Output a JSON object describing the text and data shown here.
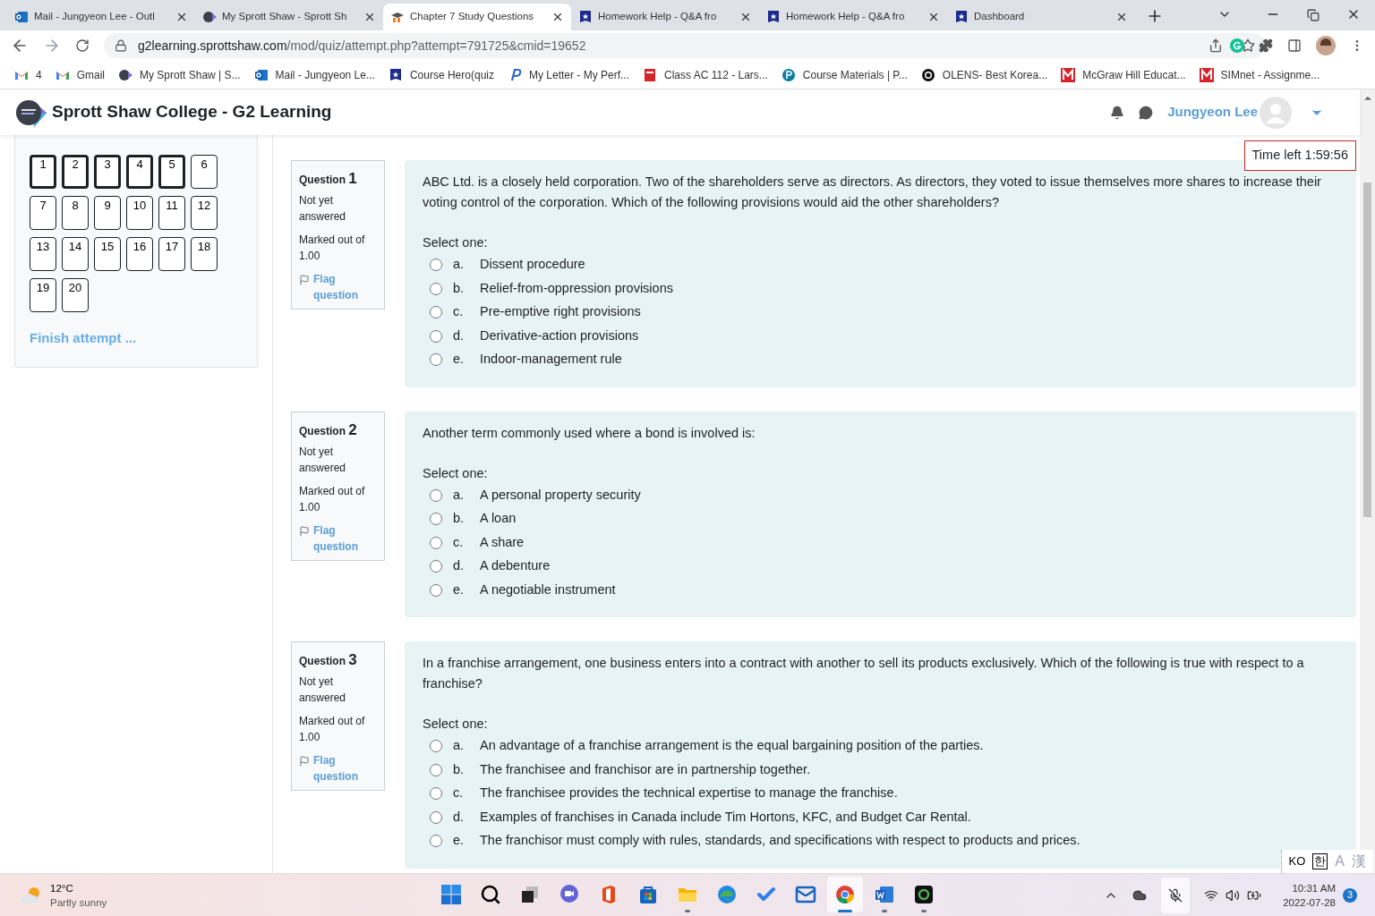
{
  "browser": {
    "tabs": [
      {
        "title": "Mail - Jungyeon Lee - Outl",
        "kind": "outlook",
        "selected": false
      },
      {
        "title": "My Sprott Shaw - Sprott Sh",
        "kind": "sprott",
        "selected": false
      },
      {
        "title": "Chapter 7 Study Questions",
        "kind": "moodle",
        "selected": true
      },
      {
        "title": "Homework Help - Q&A fro",
        "kind": "coursehero",
        "selected": false
      },
      {
        "title": "Homework Help - Q&A fro",
        "kind": "coursehero",
        "selected": false
      },
      {
        "title": "Dashboard",
        "kind": "coursehero",
        "selected": false
      }
    ],
    "url_host": "g2learning.sprottshaw.com",
    "url_path": "/mod/quiz/attempt.php?attempt=791725&cmid=19652",
    "bookmarks": [
      {
        "label": "4",
        "kind": "gmail"
      },
      {
        "label": "Gmail",
        "kind": "gmail"
      },
      {
        "label": "My Sprott Shaw | S...",
        "kind": "sprott"
      },
      {
        "label": "Mail - Jungyeon Le...",
        "kind": "outlook"
      },
      {
        "label": "Course Hero(quiz",
        "kind": "coursehero"
      },
      {
        "label": "My Letter - My Perf...",
        "kind": "pletter"
      },
      {
        "label": "Class AC 112 - Lars...",
        "kind": "mcgraw_small"
      },
      {
        "label": "Course Materials | P...",
        "kind": "pearson"
      },
      {
        "label": "OLENS- Best Korea...",
        "kind": "olens"
      },
      {
        "label": "McGraw Hill Educat...",
        "kind": "mcgraw"
      },
      {
        "label": "SIMnet - Assignme...",
        "kind": "mcgraw"
      }
    ]
  },
  "site": {
    "title": "Sprott Shaw College - G2 Learning",
    "user_name": "Jungyeon Lee"
  },
  "timer": "Time left 1:59:56",
  "quiz_nav": {
    "buttons": [
      {
        "label": "1",
        "on_page": true
      },
      {
        "label": "2",
        "on_page": true
      },
      {
        "label": "3",
        "on_page": true
      },
      {
        "label": "4",
        "on_page": true
      },
      {
        "label": "5",
        "on_page": true
      },
      {
        "label": "6",
        "on_page": false
      },
      {
        "label": "7",
        "on_page": false
      },
      {
        "label": "8",
        "on_page": false
      },
      {
        "label": "9",
        "on_page": false
      },
      {
        "label": "10",
        "on_page": false
      },
      {
        "label": "11",
        "on_page": false
      },
      {
        "label": "12",
        "on_page": false
      },
      {
        "label": "13",
        "on_page": false
      },
      {
        "label": "14",
        "on_page": false
      },
      {
        "label": "15",
        "on_page": false
      },
      {
        "label": "16",
        "on_page": false
      },
      {
        "label": "17",
        "on_page": false
      },
      {
        "label": "18",
        "on_page": false
      },
      {
        "label": "19",
        "on_page": false
      },
      {
        "label": "20",
        "on_page": false
      }
    ],
    "finish_link": "Finish attempt ..."
  },
  "questions": [
    {
      "label": "Question",
      "number": "1",
      "status": "Not yet answered",
      "marked": "Marked out of 1.00",
      "flag": "Flag question",
      "text": "ABC Ltd. is a closely held corporation. Two of the shareholders serve as directors. As directors, they voted to issue themselves more shares to increase their voting control of the corporation. Which of the following provisions would aid the other shareholders?",
      "prompt": "Select one:",
      "options": [
        {
          "letter": "a.",
          "text": "Dissent procedure",
          "selected": false
        },
        {
          "letter": "b.",
          "text": "Relief-from-oppression provisions",
          "selected": false
        },
        {
          "letter": "c.",
          "text": "Pre-emptive right provisions",
          "selected": false
        },
        {
          "letter": "d.",
          "text": "Derivative-action provisions",
          "selected": false
        },
        {
          "letter": "e.",
          "text": "Indoor-management rule",
          "selected": false
        }
      ]
    },
    {
      "label": "Question",
      "number": "2",
      "status": "Not yet answered",
      "marked": "Marked out of 1.00",
      "flag": "Flag question",
      "text": "Another term commonly used where a bond is involved is:",
      "prompt": "Select one:",
      "options": [
        {
          "letter": "a.",
          "text": "A personal property security",
          "selected": false
        },
        {
          "letter": "b.",
          "text": "A loan",
          "selected": false
        },
        {
          "letter": "c.",
          "text": "A share",
          "selected": false
        },
        {
          "letter": "d.",
          "text": "A debenture",
          "selected": false
        },
        {
          "letter": "e.",
          "text": "A negotiable instrument",
          "selected": false
        }
      ]
    },
    {
      "label": "Question",
      "number": "3",
      "status": "Not yet answered",
      "marked": "Marked out of 1.00",
      "flag": "Flag question",
      "text": "In a franchise arrangement, one business enters into a contract with another to sell its products exclusively. Which of the following is true with respect to a franchise?",
      "prompt": "Select one:",
      "options": [
        {
          "letter": "a.",
          "text": "An advantage of a franchise arrangement is the equal bargaining position of the parties.",
          "selected": false
        },
        {
          "letter": "b.",
          "text": "The franchisee and franchisor are in partnership together.",
          "selected": false
        },
        {
          "letter": "c.",
          "text": "The franchisee provides the technical expertise to manage the franchise.",
          "selected": false
        },
        {
          "letter": "d.",
          "text": "Examples of franchises in Canada include Tim Hortons, KFC, and Budget Car Rental.",
          "selected": false
        },
        {
          "letter": "e.",
          "text": "The franchisor must comply with rules, standards, and specifications with respect to products and prices.",
          "selected": false
        }
      ]
    }
  ],
  "language_bar": [
    "KO",
    "한",
    "A",
    "漢"
  ],
  "taskbar": {
    "weather": {
      "temp": "12°C",
      "condition": "Partly sunny"
    },
    "apps": [
      {
        "kind": "start",
        "running": false,
        "selected": false
      },
      {
        "kind": "search",
        "running": false,
        "selected": false
      },
      {
        "kind": "taskview",
        "running": false,
        "selected": false
      },
      {
        "kind": "chat",
        "running": false,
        "selected": false
      },
      {
        "kind": "office",
        "running": false,
        "selected": false
      },
      {
        "kind": "store",
        "running": false,
        "selected": false
      },
      {
        "kind": "explorer",
        "running": true,
        "selected": false
      },
      {
        "kind": "edge",
        "running": false,
        "selected": false
      },
      {
        "kind": "todo",
        "running": false,
        "selected": false
      },
      {
        "kind": "mail",
        "running": false,
        "selected": false
      },
      {
        "kind": "chrome",
        "running": true,
        "selected": true
      },
      {
        "kind": "word",
        "running": true,
        "selected": false
      },
      {
        "kind": "teams",
        "running": true,
        "selected": false
      }
    ],
    "time": "10:31 AM",
    "date": "2022-07-28",
    "notifications": "3"
  }
}
